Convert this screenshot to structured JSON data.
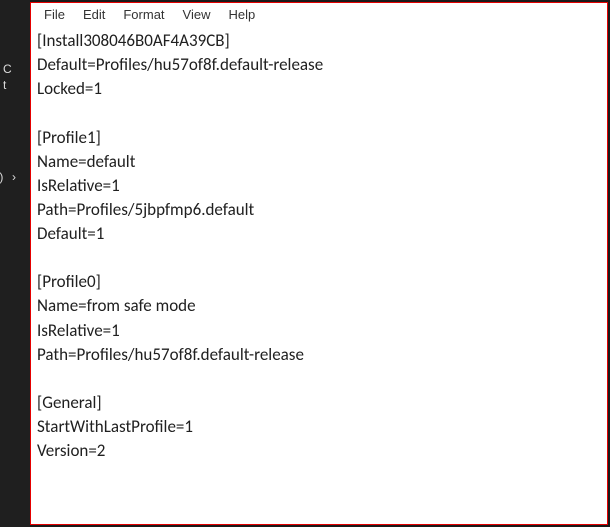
{
  "sidebar": {
    "frag1": "C",
    "frag2": "t",
    "frag3": ":)",
    "frag4": "›"
  },
  "menu": {
    "file": "File",
    "edit": "Edit",
    "format": "Format",
    "view": "View",
    "help": "Help"
  },
  "content": {
    "lines": [
      "[Install308046B0AF4A39CB]",
      "Default=Profiles/hu57of8f.default-release",
      "Locked=1",
      "",
      "[Profile1]",
      "Name=default",
      "IsRelative=1",
      "Path=Profiles/5jbpfmp6.default",
      "Default=1",
      "",
      "[Profile0]",
      "Name=from safe mode",
      "IsRelative=1",
      "Path=Profiles/hu57of8f.default-release",
      "",
      "[General]",
      "StartWithLastProfile=1",
      "Version=2"
    ]
  }
}
